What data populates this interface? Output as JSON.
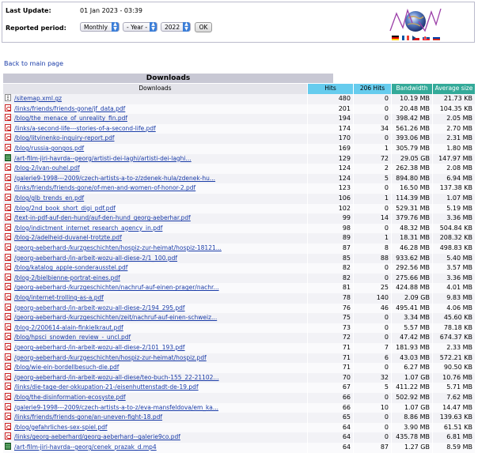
{
  "header": {
    "last_update_label": "Last Update:",
    "last_update_value": "01 Jan 2023 - 03:39",
    "reported_period_label": "Reported period:",
    "period_type": "Monthly",
    "month": "- Year -",
    "year": "2022",
    "ok_label": "OK",
    "flags": [
      "de",
      "fr",
      "cz",
      "sk",
      "ru"
    ]
  },
  "back_link": "Back to main page",
  "downloads": {
    "title": "Downloads",
    "columns": [
      "Downloads",
      "Hits",
      "206 Hits",
      "Bandwidth",
      "Average size"
    ],
    "column_colors": {
      "hits": "#66ccee",
      "bandwidth": "#33aa99"
    },
    "rows": [
      {
        "icon": "gz",
        "name": "/sitemap.xml.gz",
        "hits": "480",
        "h206": "0",
        "bw": "10.19 MB",
        "avg": "21.73 KB"
      },
      {
        "icon": "pdf",
        "name": "/links/friends/friends-gone/jf_data.pdf",
        "hits": "201",
        "h206": "0",
        "bw": "20.48 MB",
        "avg": "104.35 KB"
      },
      {
        "icon": "pdf",
        "name": "/blog/the_menace_of_unreality_fin.pdf",
        "hits": "194",
        "h206": "0",
        "bw": "398.42 MB",
        "avg": "2.05 MB"
      },
      {
        "icon": "pdf",
        "name": "/links/a-second-life---stories-of-a-second-life.pdf",
        "hits": "174",
        "h206": "34",
        "bw": "561.26 MB",
        "avg": "2.70 MB"
      },
      {
        "icon": "pdf",
        "name": "/blog/litvinenko-inquiry-report.pdf",
        "hits": "170",
        "h206": "0",
        "bw": "393.06 MB",
        "avg": "2.31 MB"
      },
      {
        "icon": "pdf",
        "name": "/blog/russia-gongos.pdf",
        "hits": "169",
        "h206": "1",
        "bw": "305.79 MB",
        "avg": "1.80 MB"
      },
      {
        "icon": "film",
        "name": "/art-film-jiri-havrda--georg/artisti-dei-laghi/artisti-dei-laghi...",
        "hits": "129",
        "h206": "72",
        "bw": "29.05 GB",
        "avg": "147.97 MB"
      },
      {
        "icon": "pdf",
        "name": "/blog-2/ivan-ouhel.pdf",
        "hits": "124",
        "h206": "2",
        "bw": "262.38 MB",
        "avg": "2.08 MB"
      },
      {
        "icon": "pdf",
        "name": "/galerie9-1998---2009/czech-artists-a-to-z/zdenek-hula/zdenek-hu...",
        "hits": "124",
        "h206": "5",
        "bw": "894.80 MB",
        "avg": "6.94 MB"
      },
      {
        "icon": "pdf",
        "name": "/links/friends/friends-gone/of-men-and-women-of-honor-2.pdf",
        "hits": "123",
        "h206": "0",
        "bw": "16.50 MB",
        "avg": "137.38 KB"
      },
      {
        "icon": "pdf",
        "name": "/blog/glb_trends_en.pdf",
        "hits": "106",
        "h206": "1",
        "bw": "114.39 MB",
        "avg": "1.07 MB"
      },
      {
        "icon": "pdf",
        "name": "/blog/2nd_book_short_digi_pdf.pdf",
        "hits": "102",
        "h206": "0",
        "bw": "529.31 MB",
        "avg": "5.19 MB"
      },
      {
        "icon": "pdf",
        "name": "/text-in-pdf-auf-den-hund/auf-den-hund_georg-aeberhar.pdf",
        "hits": "99",
        "h206": "14",
        "bw": "379.76 MB",
        "avg": "3.36 MB"
      },
      {
        "icon": "pdf",
        "name": "/blog/indictment_internet_research_agency_in.pdf",
        "hits": "98",
        "h206": "0",
        "bw": "48.32 MB",
        "avg": "504.84 KB"
      },
      {
        "icon": "pdf",
        "name": "/blog-2/adelheid-duvanel-trotzte.pdf",
        "hits": "89",
        "h206": "1",
        "bw": "18.31 MB",
        "avg": "208.32 KB"
      },
      {
        "icon": "pdf",
        "name": "/georg-aeberhard-/kurzgeschichten/hospiz-zur-heimat/hospiz-18121...",
        "hits": "87",
        "h206": "8",
        "bw": "46.28 MB",
        "avg": "498.83 KB"
      },
      {
        "icon": "pdf",
        "name": "/georg-aeberhard-/in-arbeit-wozu-all-diese-2/1_100.pdf",
        "hits": "85",
        "h206": "88",
        "bw": "933.62 MB",
        "avg": "5.40 MB"
      },
      {
        "icon": "pdf",
        "name": "/blog/katalog_apple-sonderausstel.pdf",
        "hits": "82",
        "h206": "0",
        "bw": "292.56 MB",
        "avg": "3.57 MB"
      },
      {
        "icon": "pdf",
        "name": "/blog-2/bielbienne-portrat-eines.pdf",
        "hits": "82",
        "h206": "0",
        "bw": "275.66 MB",
        "avg": "3.36 MB"
      },
      {
        "icon": "pdf",
        "name": "/georg-aeberhard-/kurzgeschichten/nachruf-auf-einen-prager/nachr...",
        "hits": "81",
        "h206": "25",
        "bw": "424.88 MB",
        "avg": "4.01 MB"
      },
      {
        "icon": "pdf",
        "name": "/blog/internet-trolling-as-a.pdf",
        "hits": "78",
        "h206": "140",
        "bw": "2.09 GB",
        "avg": "9.83 MB"
      },
      {
        "icon": "pdf",
        "name": "/georg-aeberhard-/in-arbeit-wozu-all-diese-2/194_295.pdf",
        "hits": "76",
        "h206": "46",
        "bw": "495.41 MB",
        "avg": "4.06 MB"
      },
      {
        "icon": "pdf",
        "name": "/georg-aeberhard-/kurzgeschichten/zeit/nachruf-auf-einen-schweiz...",
        "hits": "75",
        "h206": "0",
        "bw": "3.34 MB",
        "avg": "45.60 KB"
      },
      {
        "icon": "pdf",
        "name": "/blog-2/200614-alain-finkielkraut.pdf",
        "hits": "73",
        "h206": "0",
        "bw": "5.57 MB",
        "avg": "78.18 KB"
      },
      {
        "icon": "pdf",
        "name": "/blog/hpsci_snowden_review_-_uncl.pdf",
        "hits": "72",
        "h206": "0",
        "bw": "47.42 MB",
        "avg": "674.37 KB"
      },
      {
        "icon": "pdf",
        "name": "/georg-aeberhard-/in-arbeit-wozu-all-diese-2/101_193.pdf",
        "hits": "71",
        "h206": "7",
        "bw": "181.93 MB",
        "avg": "2.33 MB"
      },
      {
        "icon": "pdf",
        "name": "/georg-aeberhard-/kurzgeschichten/hospiz-zur-heimat/hospiz.pdf",
        "hits": "71",
        "h206": "6",
        "bw": "43.03 MB",
        "avg": "572.21 KB"
      },
      {
        "icon": "pdf",
        "name": "/blog/wie-ein-bordellbesuch-die.pdf",
        "hits": "71",
        "h206": "0",
        "bw": "6.27 MB",
        "avg": "90.50 KB"
      },
      {
        "icon": "pdf",
        "name": "/georg-aeberhard-/in-arbeit-wozu-all-diese/teo-buch-155_22-21102...",
        "hits": "70",
        "h206": "32",
        "bw": "1.07 GB",
        "avg": "10.76 MB"
      },
      {
        "icon": "pdf",
        "name": "/links/die-tage-der-okkupation-21-/eisenhuttenstadt-de-19.pdf",
        "hits": "67",
        "h206": "5",
        "bw": "411.22 MB",
        "avg": "5.71 MB"
      },
      {
        "icon": "pdf",
        "name": "/blog/the-disinformation-ecosyste.pdf",
        "hits": "66",
        "h206": "0",
        "bw": "502.92 MB",
        "avg": "7.62 MB"
      },
      {
        "icon": "pdf",
        "name": "/galerie9-1998---2009/czech-artists-a-to-z/eva-mansfeldova/em_ka...",
        "hits": "66",
        "h206": "10",
        "bw": "1.07 GB",
        "avg": "14.47 MB"
      },
      {
        "icon": "pdf",
        "name": "/links/friends/friends-gone/an-uneven-fight-18.pdf",
        "hits": "65",
        "h206": "0",
        "bw": "8.86 MB",
        "avg": "139.63 KB"
      },
      {
        "icon": "pdf",
        "name": "/blog/gefahrliches-sex-spiel.pdf",
        "hits": "64",
        "h206": "0",
        "bw": "3.90 MB",
        "avg": "61.51 KB"
      },
      {
        "icon": "pdf",
        "name": "/links/georg-aeberhard/georg-aeberhard--galerie9co.pdf",
        "hits": "64",
        "h206": "0",
        "bw": "435.78 MB",
        "avg": "6.81 MB"
      },
      {
        "icon": "film",
        "name": "/art-film-jiri-havrda--georg/cenek_prazak_d.mp4",
        "hits": "64",
        "h206": "87",
        "bw": "1.27 GB",
        "avg": "8.59 MB"
      }
    ]
  }
}
